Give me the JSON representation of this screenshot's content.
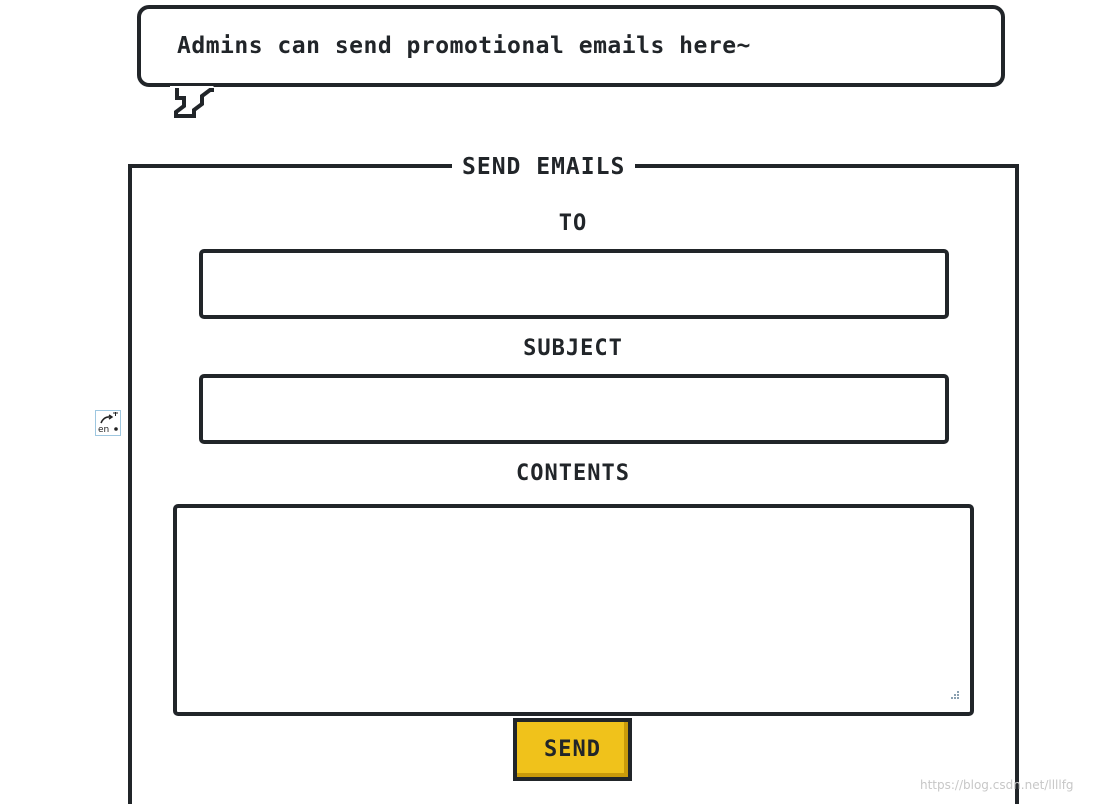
{
  "balloon": {
    "text": "Admins can send promotional emails here~"
  },
  "form": {
    "title": "SEND EMAILS",
    "to_label": "TO",
    "to_value": "",
    "subject_label": "SUBJECT",
    "subject_value": "",
    "contents_label": "CONTENTS",
    "contents_value": "",
    "send_label": "SEND"
  },
  "icons": {
    "translate": "translate-en-icon",
    "resize": "resize-grip-icon"
  },
  "watermark": "https://blog.csdn.net/llllfg",
  "colors": {
    "border": "#212529",
    "button": "#f0c21b",
    "background": "#ffffff"
  }
}
